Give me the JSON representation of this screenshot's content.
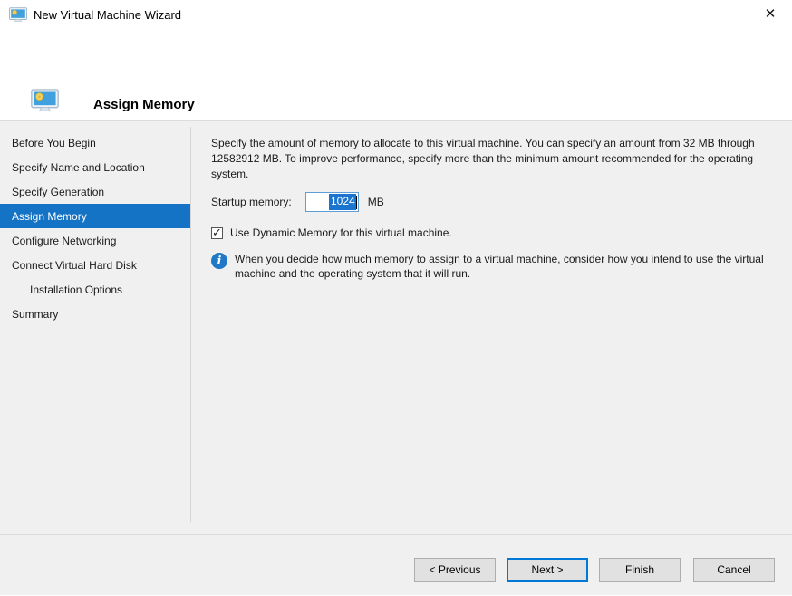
{
  "window": {
    "title": "New Virtual Machine Wizard",
    "close_icon": "✕"
  },
  "header": {
    "title": "Assign Memory"
  },
  "icons": {
    "app_icon": "vm-monitor-icon",
    "header_icon": "vm-monitor-icon",
    "info_icon": "info-circle-icon",
    "checkbox_check": "✓"
  },
  "sidebar": {
    "items": [
      {
        "label": "Before You Begin",
        "selected": false,
        "indent": false
      },
      {
        "label": "Specify Name and Location",
        "selected": false,
        "indent": false
      },
      {
        "label": "Specify Generation",
        "selected": false,
        "indent": false
      },
      {
        "label": "Assign Memory",
        "selected": true,
        "indent": false
      },
      {
        "label": "Configure Networking",
        "selected": false,
        "indent": false
      },
      {
        "label": "Connect Virtual Hard Disk",
        "selected": false,
        "indent": false
      },
      {
        "label": "Installation Options",
        "selected": false,
        "indent": true
      },
      {
        "label": "Summary",
        "selected": false,
        "indent": false
      }
    ]
  },
  "content": {
    "description": "Specify the amount of memory to allocate to this virtual machine. You can specify an amount from 32 MB through 12582912 MB. To improve performance, specify more than the minimum amount recommended for the operating system.",
    "startup_memory": {
      "label": "Startup memory:",
      "value": "1024",
      "unit": "MB"
    },
    "dynamic_memory": {
      "label": "Use Dynamic Memory for this virtual machine.",
      "checked": true
    },
    "info_note": "When you decide how much memory to assign to a virtual machine, consider how you intend to use the virtual machine and the operating system that it will run."
  },
  "buttons": {
    "previous": "< Previous",
    "next": "Next >",
    "finish": "Finish",
    "cancel": "Cancel"
  },
  "colors": {
    "accent": "#0078d7",
    "selected_step_bg": "#1473c5",
    "selection_bg": "#1b75cf",
    "info_icon_bg": "#2079c6"
  }
}
